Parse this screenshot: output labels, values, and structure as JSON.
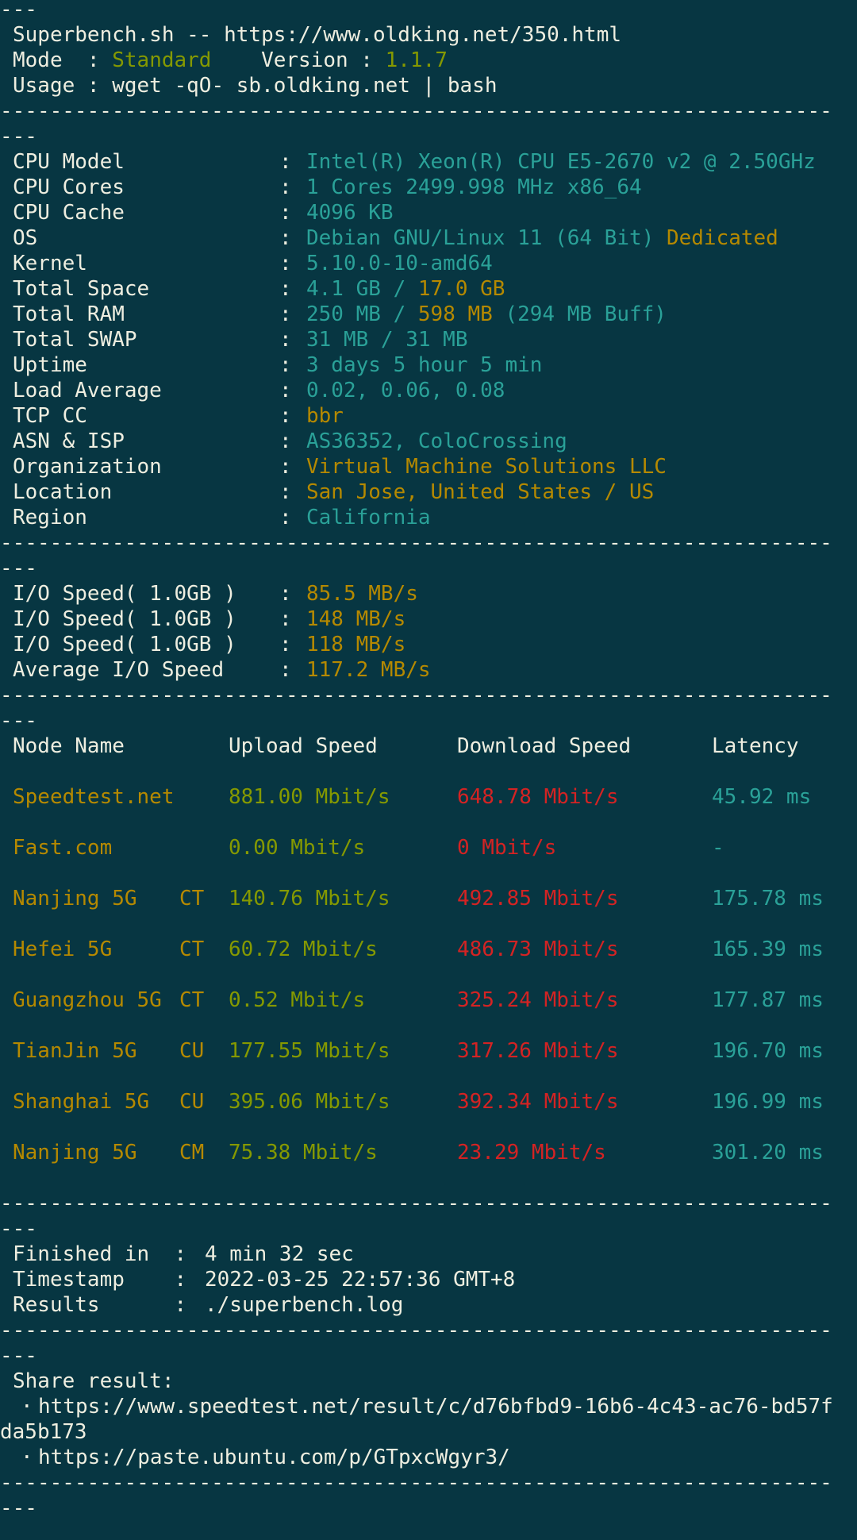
{
  "colors": {
    "background": "#073642",
    "text": "#eeeee0",
    "green": "#859900",
    "yellow": "#b58900",
    "cyan": "#2aa198",
    "red": "#d42323"
  },
  "separator_line": "-------------------------------------------------------------------",
  "separator_wrap": "---",
  "header": {
    "title": "Superbench.sh -- https://www.oldking.net/350.html",
    "mode_label": "Mode  : ",
    "mode_value": "Standard",
    "version_label": "    Version : ",
    "version_value": "1.1.7",
    "usage": "Usage : wget -qO- sb.oldking.net | bash"
  },
  "system_info": [
    {
      "label": "CPU Model",
      "value": [
        {
          "t": "Intel(R) Xeon(R) CPU E5-2670 v2 @ 2.50GHz",
          "c": "cy"
        }
      ]
    },
    {
      "label": "CPU Cores",
      "value": [
        {
          "t": "1 Cores 2499.998 MHz x86_64",
          "c": "cy"
        }
      ]
    },
    {
      "label": "CPU Cache",
      "value": [
        {
          "t": "4096 KB",
          "c": "cy"
        }
      ]
    },
    {
      "label": "OS",
      "value": [
        {
          "t": "Debian GNU/Linux 11 (64 Bit) ",
          "c": "cy"
        },
        {
          "t": "Dedicated",
          "c": "y"
        }
      ]
    },
    {
      "label": "Kernel",
      "value": [
        {
          "t": "5.10.0-10-amd64",
          "c": "cy"
        }
      ]
    },
    {
      "label": "Total Space",
      "value": [
        {
          "t": "4.1 GB / ",
          "c": "cy"
        },
        {
          "t": "17.0 GB",
          "c": "y"
        }
      ]
    },
    {
      "label": "Total RAM",
      "value": [
        {
          "t": "250 MB / ",
          "c": "cy"
        },
        {
          "t": "598 MB",
          "c": "y"
        },
        {
          "t": " (294 MB Buff)",
          "c": "cy"
        }
      ]
    },
    {
      "label": "Total SWAP",
      "value": [
        {
          "t": "31 MB / 31 MB",
          "c": "cy"
        }
      ]
    },
    {
      "label": "Uptime",
      "value": [
        {
          "t": "3 days 5 hour 5 min",
          "c": "cy"
        }
      ]
    },
    {
      "label": "Load Average",
      "value": [
        {
          "t": "0.02, 0.06, 0.08",
          "c": "cy"
        }
      ]
    },
    {
      "label": "TCP CC",
      "value": [
        {
          "t": "bbr",
          "c": "y"
        }
      ]
    },
    {
      "label": "ASN & ISP",
      "value": [
        {
          "t": "AS36352, ColoCrossing",
          "c": "cy"
        }
      ]
    },
    {
      "label": "Organization",
      "value": [
        {
          "t": "Virtual Machine Solutions LLC",
          "c": "y"
        }
      ]
    },
    {
      "label": "Location",
      "value": [
        {
          "t": "San Jose, United States / US",
          "c": "y"
        }
      ]
    },
    {
      "label": "Region",
      "value": [
        {
          "t": "California",
          "c": "cy"
        }
      ]
    }
  ],
  "io": [
    {
      "label": "I/O Speed( 1.0GB )",
      "value": "85.5 MB/s"
    },
    {
      "label": "I/O Speed( 1.0GB )",
      "value": "148 MB/s"
    },
    {
      "label": "I/O Speed( 1.0GB )",
      "value": "118 MB/s"
    },
    {
      "label": "Average I/O Speed",
      "value": "117.2 MB/s"
    }
  ],
  "speedtest": {
    "columns": [
      "Node Name",
      "Upload Speed",
      "Download Speed",
      "Latency"
    ],
    "rows": [
      {
        "node": "Speedtest.net",
        "isp": "",
        "upload": "881.00 Mbit/s",
        "download": "648.78 Mbit/s",
        "latency": "45.92 ms"
      },
      {
        "node": "Fast.com",
        "isp": "",
        "upload": "0.00 Mbit/s",
        "download": "0 Mbit/s",
        "latency": "-"
      },
      {
        "node": "Nanjing 5G",
        "isp": "CT",
        "upload": "140.76 Mbit/s",
        "download": "492.85 Mbit/s",
        "latency": "175.78 ms"
      },
      {
        "node": "Hefei 5G",
        "isp": "CT",
        "upload": "60.72 Mbit/s",
        "download": "486.73 Mbit/s",
        "latency": "165.39 ms"
      },
      {
        "node": "Guangzhou 5G",
        "isp": "CT",
        "upload": "0.52 Mbit/s",
        "download": "325.24 Mbit/s",
        "latency": "177.87 ms"
      },
      {
        "node": "TianJin 5G",
        "isp": "CU",
        "upload": "177.55 Mbit/s",
        "download": "317.26 Mbit/s",
        "latency": "196.70 ms"
      },
      {
        "node": "Shanghai 5G",
        "isp": "CU",
        "upload": "395.06 Mbit/s",
        "download": "392.34 Mbit/s",
        "latency": "196.99 ms"
      },
      {
        "node": "Nanjing 5G",
        "isp": "CM",
        "upload": "75.38 Mbit/s",
        "download": "23.29 Mbit/s",
        "latency": "301.20 ms"
      }
    ]
  },
  "summary": [
    {
      "label": "Finished in  : ",
      "value": "4 min 32 sec"
    },
    {
      "label": "Timestamp    : ",
      "value": "2022-03-25 22:57:36 GMT+8"
    },
    {
      "label": "Results      : ",
      "value": "./superbench.log"
    }
  ],
  "share": {
    "title": "Share result:",
    "links": [
      {
        "bullet": "·",
        "line1": "https://www.speedtest.net/result/c/d76bfbd9-16b6-4c43-ac76-bd57f",
        "line2": "da5b173"
      },
      {
        "bullet": "·",
        "line1": "https://paste.ubuntu.com/p/GTpxcWgyr3/"
      }
    ]
  }
}
